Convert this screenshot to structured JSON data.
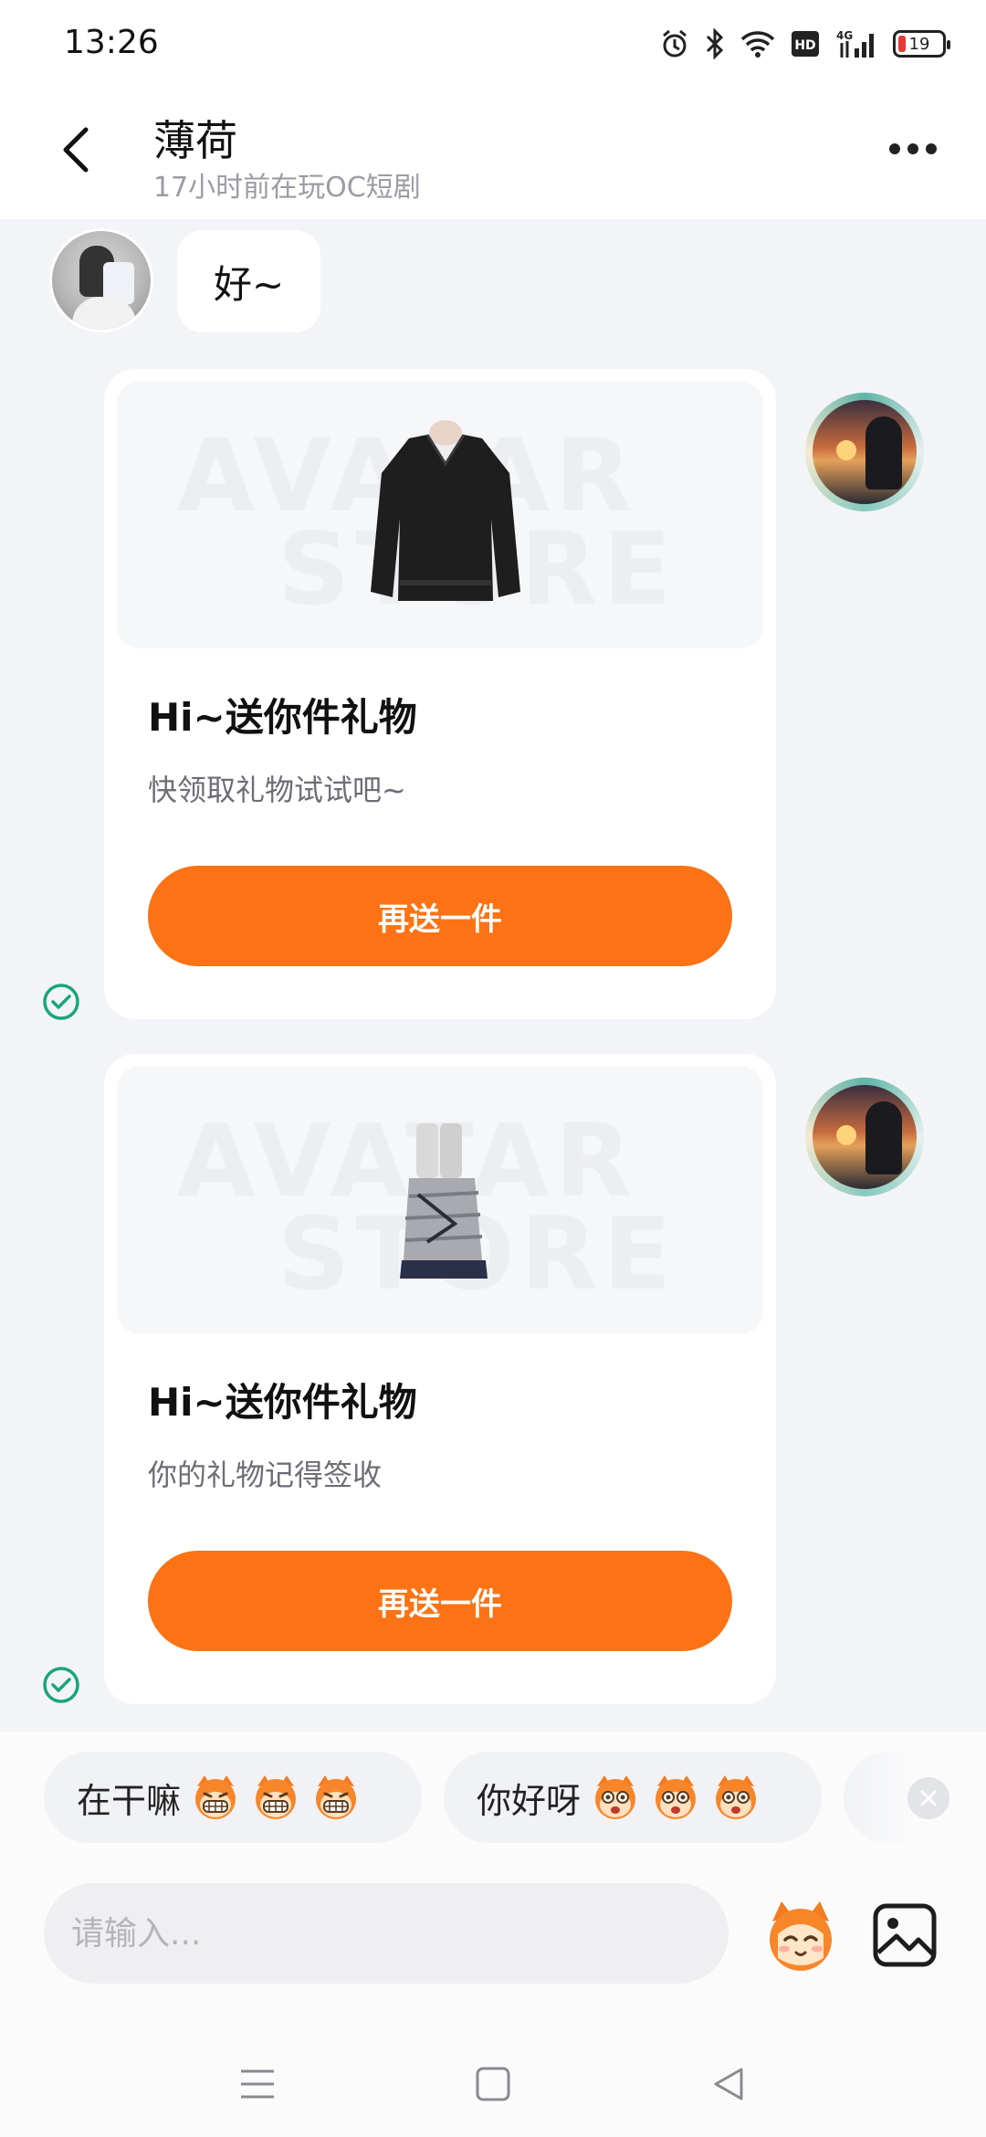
{
  "status_bar": {
    "time": "13:26",
    "battery_level": "19",
    "network": "4G",
    "icons": [
      "alarm-icon",
      "bluetooth-icon",
      "wifi-icon",
      "hd-icon",
      "signal-icon",
      "battery-icon"
    ]
  },
  "header": {
    "title": "薄荷",
    "subtitle": "17小时前在玩OC短剧"
  },
  "messages": {
    "incoming_text": "好~",
    "gift_cards": [
      {
        "title": "Hi~送你件礼物",
        "description": "快领取礼物试试吧~",
        "button_label": "再送一件",
        "item_icon": "sweater-icon",
        "watermark": "AVATAR STORE"
      },
      {
        "title": "Hi~送你件礼物",
        "description": "你的礼物记得签收",
        "button_label": "再送一件",
        "item_icon": "leg-warmers-icon",
        "watermark": "AVATAR STORE"
      }
    ]
  },
  "quick_replies": [
    {
      "label": "在干嘛"
    },
    {
      "label": "你好呀"
    }
  ],
  "composer": {
    "placeholder": "请输入..."
  },
  "colors": {
    "accent": "#fb7314",
    "background": "#f3f4f8",
    "sent_check": "#1aa57a"
  }
}
